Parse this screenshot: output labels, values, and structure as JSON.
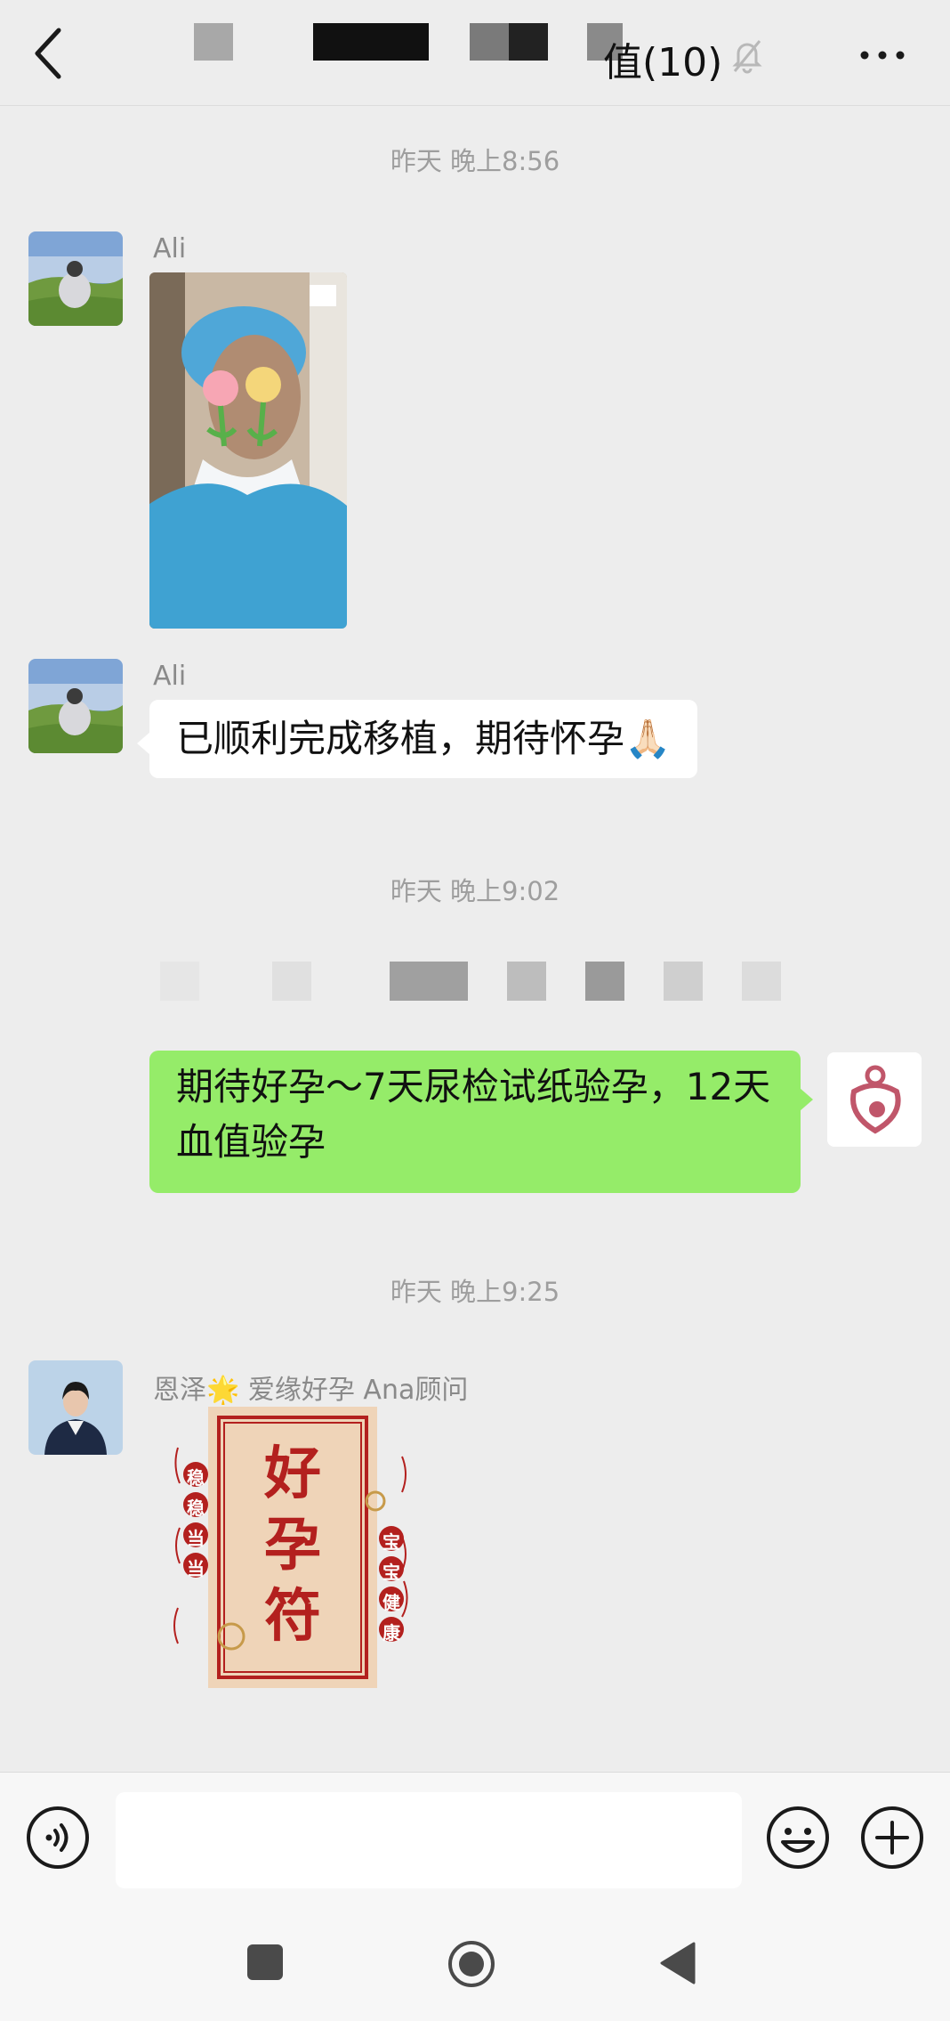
{
  "header": {
    "title_suffix": "值(10)",
    "back_icon": "chevron-left-icon",
    "mute_icon": "bell-off-icon",
    "more_icon": "more-dots-icon"
  },
  "messages": {
    "time_1": "昨天 晚上8:56",
    "sender_ali_1": "Ali",
    "sender_ali_2": "Ali",
    "ali_text": "已顺利完成移植，期待怀孕🙏🏻",
    "time_2": "昨天 晚上9:02",
    "outgoing_text": "期待好孕～7天尿检试纸验孕，12天血值验孕",
    "time_3": "昨天 晚上9:25",
    "sender_consultant": "恩泽🌟 爱缘好孕 Ana顾问",
    "sticker": {
      "title": "好孕符",
      "left_text": "稳稳当当",
      "right_text": "宝宝健康"
    }
  },
  "input_bar": {
    "placeholder": "",
    "voice_icon": "voice-icon",
    "emoji_icon": "emoji-icon",
    "plus_icon": "plus-icon"
  },
  "nav": {
    "recent_icon": "square-icon",
    "home_icon": "circle-icon",
    "back_icon": "triangle-back-icon"
  },
  "colors": {
    "background": "#ededed",
    "outgoing_bubble": "#95ec69",
    "incoming_bubble": "#ffffff",
    "sticker_red": "#b3201e"
  }
}
